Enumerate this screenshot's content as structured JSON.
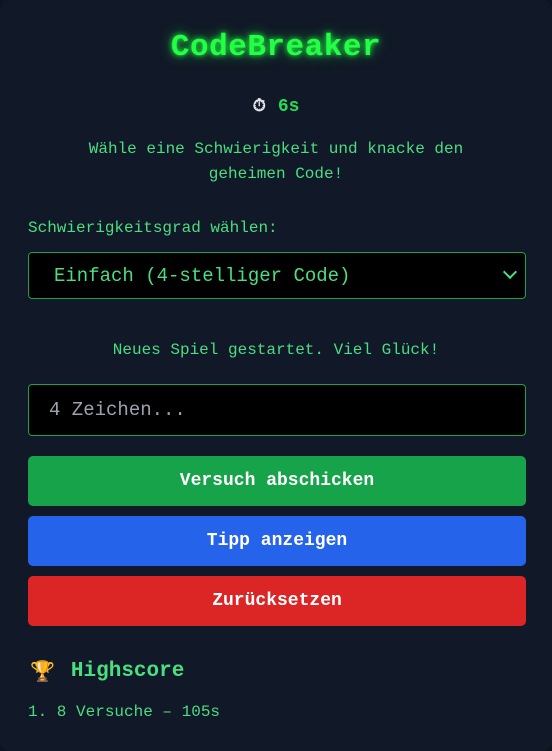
{
  "app": {
    "title": "CodeBreaker",
    "timer_icon": "stopwatch-icon",
    "timer_value": "6s",
    "subtitle": "Wähle eine Schwierigkeit und knacke den geheimen Code!"
  },
  "difficulty": {
    "label": "Schwierigkeitsgrad wählen:",
    "selected": "Einfach (4-stelliger Code)"
  },
  "status_message": "Neues Spiel gestartet. Viel Glück!",
  "guess": {
    "value": "",
    "placeholder": "4 Zeichen..."
  },
  "buttons": {
    "submit": "Versuch abschicken",
    "hint": "Tipp anzeigen",
    "reset": "Zurücksetzen"
  },
  "highscore": {
    "icon": "trophy-icon",
    "title": "Highscore",
    "entries": [
      "1. 8 Versuche – 105s"
    ]
  },
  "colors": {
    "accent_green": "#22ff44",
    "text_green": "#4ade80",
    "submit_button": "#16a34a",
    "hint_button": "#2563eb",
    "reset_button": "#dc2626",
    "background": "#111827"
  }
}
